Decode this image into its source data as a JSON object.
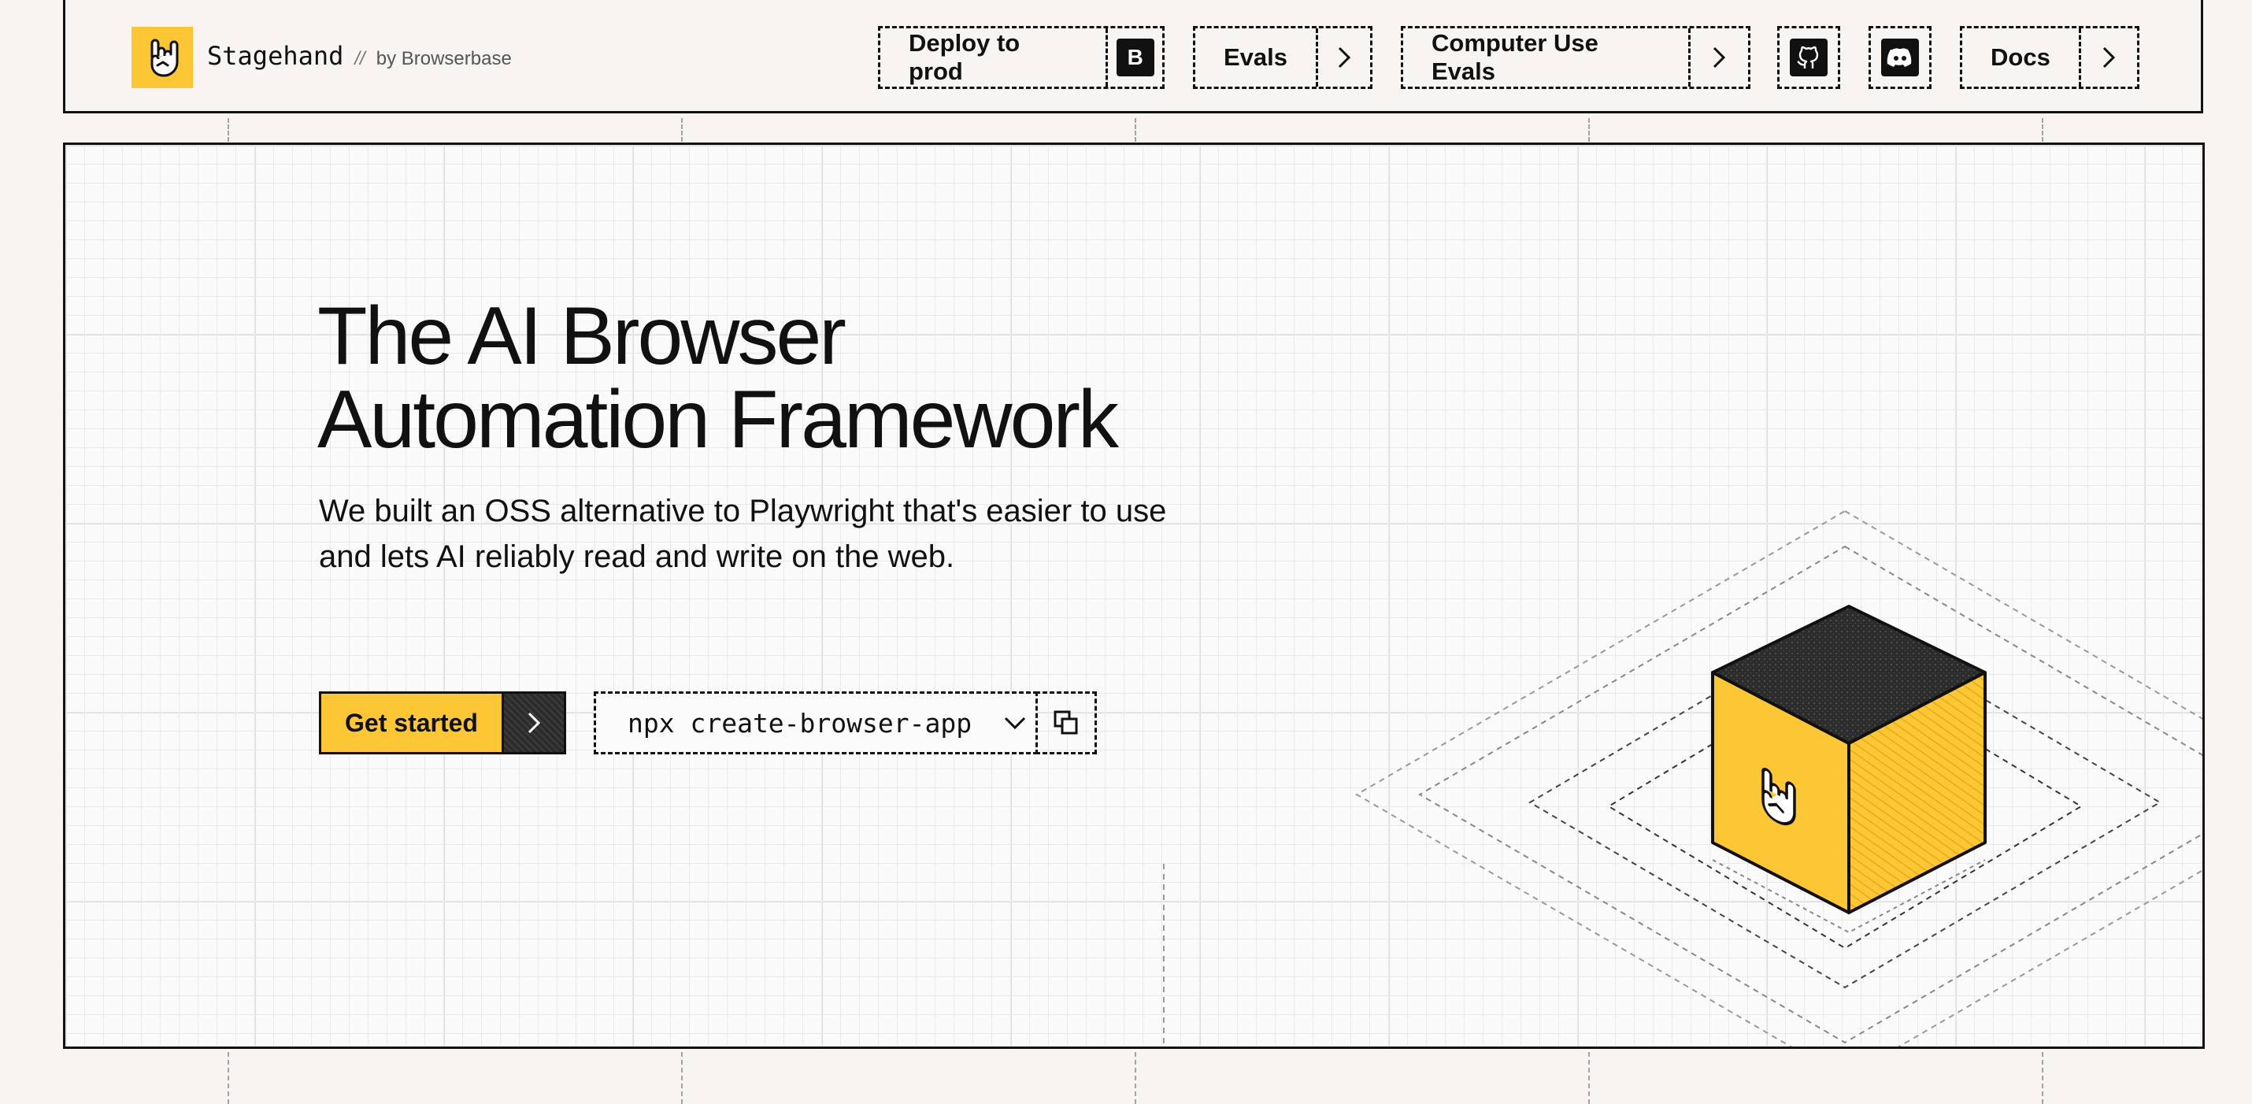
{
  "brand": {
    "name": "Stagehand",
    "separator": "//",
    "by": "by Browserbase",
    "accent": "#fdc635"
  },
  "nav": {
    "deploy": {
      "label": "Deploy to prod",
      "badge": "B"
    },
    "evals": {
      "label": "Evals",
      "icon": "chevron-right-icon"
    },
    "cu_evals": {
      "label": "Computer Use Evals",
      "icon": "chevron-right-icon"
    },
    "github": {
      "icon": "github-icon"
    },
    "discord": {
      "icon": "discord-icon"
    },
    "docs": {
      "label": "Docs",
      "icon": "chevron-right-icon"
    }
  },
  "hero": {
    "title_line1": "The AI Browser",
    "title_line2": "Automation Framework",
    "subtitle": "We built an OSS alternative to Playwright that's easier to use and lets AI reliably read and write on the web.",
    "cta_label": "Get started",
    "command": "npx create-browser-app",
    "command_icon": "chevron-down-icon",
    "copy_icon": "copy-icon",
    "illustration_icon": "rock-hand-icon"
  }
}
